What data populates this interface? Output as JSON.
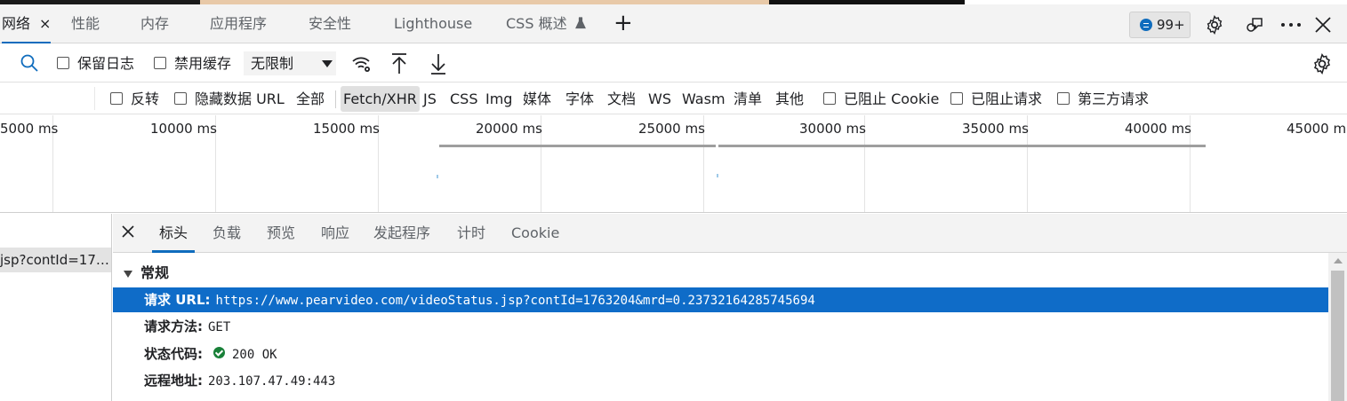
{
  "main_tabs": [
    {
      "label": "网络",
      "active": true,
      "close": "×"
    },
    {
      "label": "性能"
    },
    {
      "label": "内存"
    },
    {
      "label": "应用程序"
    },
    {
      "label": "安全性"
    },
    {
      "label": "Lighthouse"
    },
    {
      "label": "CSS 概述",
      "icon": "flask-icon"
    }
  ],
  "new_tab_label": "+",
  "issues_count": "99+",
  "toolbar": {
    "preserve_log": "保留日志",
    "disable_cache": "禁用缓存",
    "throttling": "无限制"
  },
  "filter": {
    "invert": "反转",
    "hide_data_urls": "隐藏数据 URL",
    "all": "全部",
    "types": [
      "Fetch/XHR",
      "JS",
      "CSS",
      "Img",
      "媒体",
      "字体",
      "文档",
      "WS",
      "Wasm",
      "清单",
      "其他"
    ],
    "blocked_cookies": "已阻止 Cookie",
    "blocked_requests": "已阻止请求",
    "third_party": "第三方请求"
  },
  "timeline_ticks": [
    "5000 ms",
    "10000 ms",
    "15000 ms",
    "20000 ms",
    "25000 ms",
    "30000 ms",
    "35000 ms",
    "40000 ms",
    "45000 m"
  ],
  "request_list": {
    "selected_name": "jsp?contId=17…"
  },
  "detail_tabs": [
    "标头",
    "负载",
    "预览",
    "响应",
    "发起程序",
    "计时",
    "Cookie"
  ],
  "details": {
    "section_title": "常规",
    "rows": [
      {
        "key": "请求 URL:",
        "value": "https://www.pearvideo.com/videoStatus.jsp?contId=1763204&mrd=0.23732164285745694"
      },
      {
        "key": "请求方法:",
        "value": "GET"
      },
      {
        "key": "状态代码:",
        "value": "200 OK"
      },
      {
        "key": "远程地址:",
        "value": "203.107.47.49:443"
      }
    ]
  },
  "colors": {
    "accent": "#0f6cbd",
    "selection": "#0f6cc8",
    "status_ok": "#188038"
  }
}
